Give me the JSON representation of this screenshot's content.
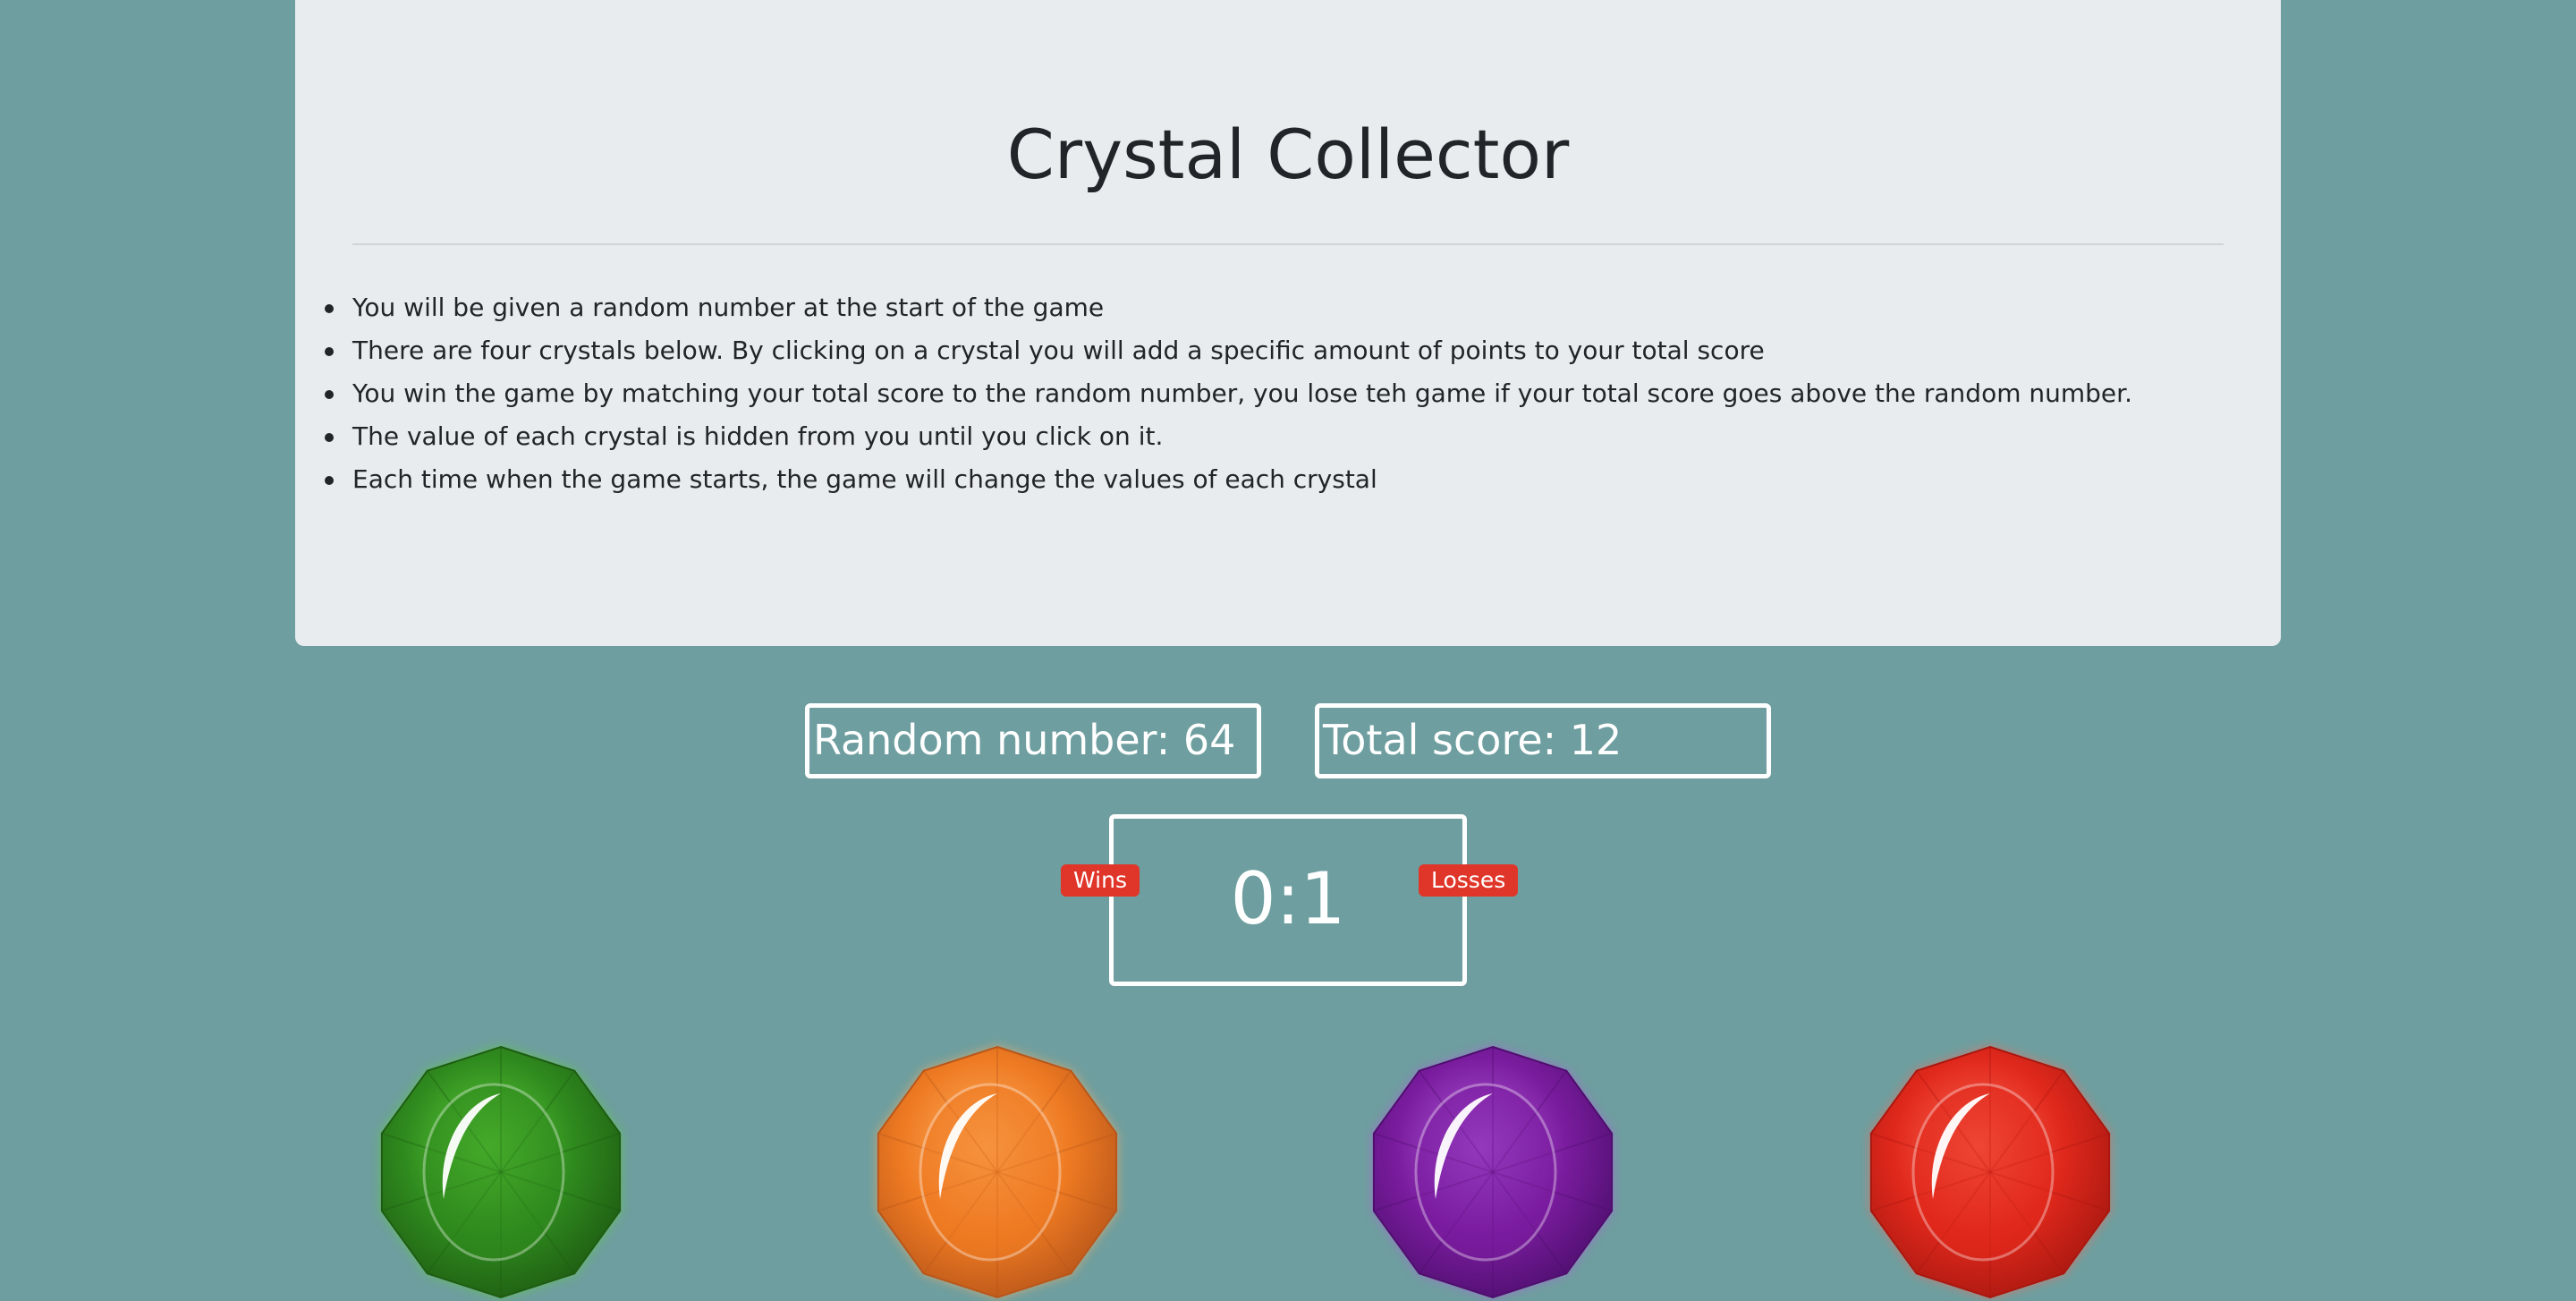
{
  "header": {
    "title": "Crystal Collector"
  },
  "rules": [
    "You will be given a random number at the start of the game",
    "There are four crystals below. By clicking on a crystal you will add a specific amount of points to your total score",
    "You win the game by matching your total score to the random number, you lose teh game if your total score goes above the random number.",
    "The value of each crystal is hidden from you until you click on it.",
    "Each time when the game starts, the game will change the values of each crystal"
  ],
  "scoreboard": {
    "random_number_text": "Random number: 64",
    "total_score_text": "Total score: 12",
    "record_text": "0:1",
    "wins_label": "Wins",
    "losses_label": "Losses"
  },
  "crystals": [
    {
      "name": "green-crystal",
      "color": "#2f8a1e",
      "dark": "#1e5c12",
      "light": "#5fd13a"
    },
    {
      "name": "orange-crystal",
      "color": "#ee7a22",
      "dark": "#b8561a",
      "light": "#ffb060"
    },
    {
      "name": "purple-crystal",
      "color": "#7a1c9e",
      "dark": "#4e0f6e",
      "light": "#b45ee0"
    },
    {
      "name": "red-crystal",
      "color": "#e0281c",
      "dark": "#a81810",
      "light": "#ff6a55"
    }
  ],
  "colors": {
    "background": "#6e9e9f",
    "panel": "#e9ecef",
    "badge": "#e0362a"
  }
}
